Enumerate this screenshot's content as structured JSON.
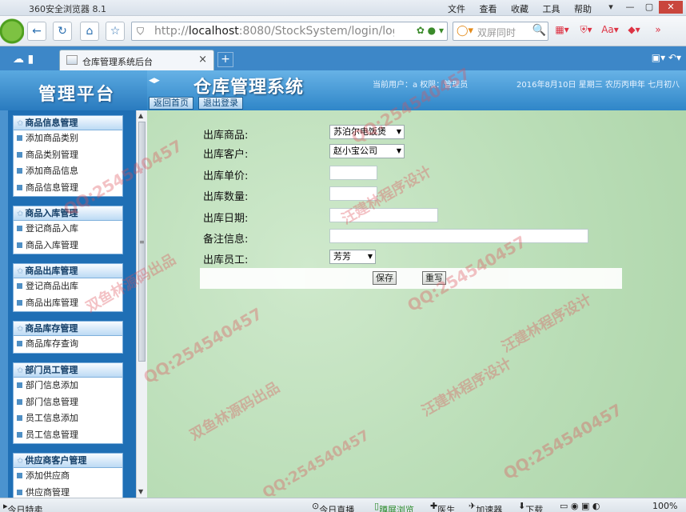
{
  "browser": {
    "title": "360安全浏览器 8.1",
    "menus": [
      "文件",
      "查看",
      "收藏",
      "工具",
      "帮助"
    ],
    "url_prefix": "http://",
    "url_host": "localhost",
    "url_rest": ":8080/StockSystem/login/logir",
    "search_placeholder": "双屏同时",
    "tab_label": "仓库管理系统后台",
    "tab_close": "×",
    "tab_add": "+"
  },
  "header": {
    "logo_text": "管理平台",
    "system_title": "仓库管理系统",
    "user_info": "当前用户：a  权限：管理员",
    "date_info": "2016年8月10日  星期三  农历丙申年  七月初八",
    "home_button": "返回首页",
    "logout_button": "退出登录"
  },
  "sidebar": {
    "groups": [
      {
        "title": "商品信息管理",
        "items": [
          "添加商品类别",
          "商品类别管理",
          "添加商品信息",
          "商品信息管理"
        ]
      },
      {
        "title": "商品入库管理",
        "items": [
          "登记商品入库",
          "商品入库管理"
        ]
      },
      {
        "title": "商品出库管理",
        "items": [
          "登记商品出库",
          "商品出库管理"
        ]
      },
      {
        "title": "商品库存管理",
        "items": [
          "商品库存查询"
        ]
      },
      {
        "title": "部门员工管理",
        "items": [
          "部门信息添加",
          "部门信息管理",
          "员工信息添加",
          "员工信息管理"
        ]
      },
      {
        "title": "供应商客户管理",
        "items": [
          "添加供应商",
          "供应商管理"
        ]
      }
    ]
  },
  "form": {
    "product_label": "出库商品:",
    "product_value": "苏泊尔电饭煲",
    "customer_label": "出库客户:",
    "customer_value": "赵小宝公司",
    "price_label": "出库单价:",
    "price_value": "",
    "qty_label": "出库数量:",
    "qty_value": "",
    "date_label": "出库日期:",
    "date_value": "",
    "remark_label": "备注信息:",
    "remark_value": "",
    "staff_label": "出库员工:",
    "staff_value": "芳芳",
    "save_button": "保存",
    "reset_button": "重写"
  },
  "statusbar": {
    "left": "今日特卖",
    "live": "今日直播",
    "dual": "蹲屏浏览",
    "doctor": "医生",
    "accel": "加速器",
    "download": "下载",
    "zoom": "100%"
  },
  "watermarks": {
    "qq": "QQ:254540457",
    "a": "双鱼林源码出品",
    "b": "汪建林程序设计"
  }
}
